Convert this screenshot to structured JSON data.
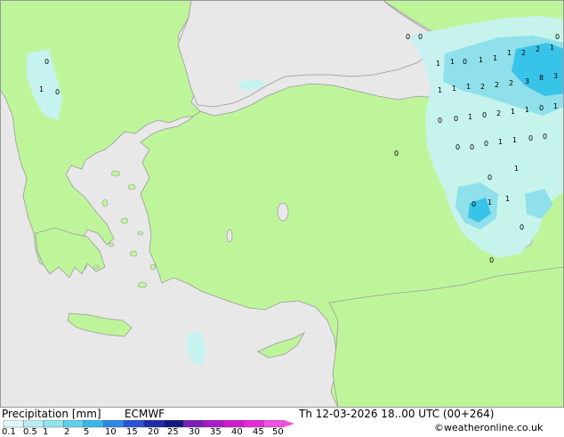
{
  "title_left": "Precipitation [mm]",
  "model": "ECMWF",
  "valid_time": "Th 12-03-2026 18..00 UTC (00+264)",
  "credit": "©weatheronline.co.uk",
  "colors": {
    "sea": "#e8e8e8",
    "land": "#bff59a",
    "coast": "#9a9a9a",
    "precip_light": "#c6f2f0",
    "precip_mid": "#8fe0ea",
    "precip_heavy": "#38c4e8"
  },
  "legend": {
    "labels": [
      "0.1",
      "0.5",
      "1",
      "2",
      "5",
      "10",
      "15",
      "20",
      "25",
      "30",
      "35",
      "40",
      "45",
      "50"
    ],
    "colors": [
      "#dff7f7",
      "#b8eef3",
      "#90e3ee",
      "#5fd0ea",
      "#35b8e6",
      "#2f86e6",
      "#2b52d8",
      "#1e2ca8",
      "#101a80",
      "#7a1fb8",
      "#a81cc8",
      "#d01ad0",
      "#e62ad8",
      "#f050e0"
    ]
  },
  "point_values": [
    {
      "label": "0"
    },
    {
      "label": "0"
    },
    {
      "label": "0"
    },
    {
      "label": "1"
    },
    {
      "label": "0"
    },
    {
      "label": "0"
    },
    {
      "label": "0"
    },
    {
      "label": "1"
    },
    {
      "label": "1"
    },
    {
      "label": "0"
    },
    {
      "label": "1"
    },
    {
      "label": "1"
    },
    {
      "label": "1"
    },
    {
      "label": "2"
    },
    {
      "label": "2"
    },
    {
      "label": "1"
    },
    {
      "label": "1"
    },
    {
      "label": "1"
    },
    {
      "label": "1"
    },
    {
      "label": "2"
    },
    {
      "label": "2"
    },
    {
      "label": "2"
    },
    {
      "label": "3"
    },
    {
      "label": "8"
    },
    {
      "label": "3"
    },
    {
      "label": "0"
    },
    {
      "label": "0"
    },
    {
      "label": "1"
    },
    {
      "label": "0"
    },
    {
      "label": "2"
    },
    {
      "label": "1"
    },
    {
      "label": "1"
    },
    {
      "label": "0"
    },
    {
      "label": "1"
    },
    {
      "label": "0"
    },
    {
      "label": "0"
    },
    {
      "label": "0"
    },
    {
      "label": "1"
    },
    {
      "label": "1"
    },
    {
      "label": "0"
    },
    {
      "label": "0"
    },
    {
      "label": "1"
    },
    {
      "label": "0"
    },
    {
      "label": "1"
    },
    {
      "label": "0"
    },
    {
      "label": "1"
    },
    {
      "label": "0"
    },
    {
      "label": "0"
    }
  ]
}
